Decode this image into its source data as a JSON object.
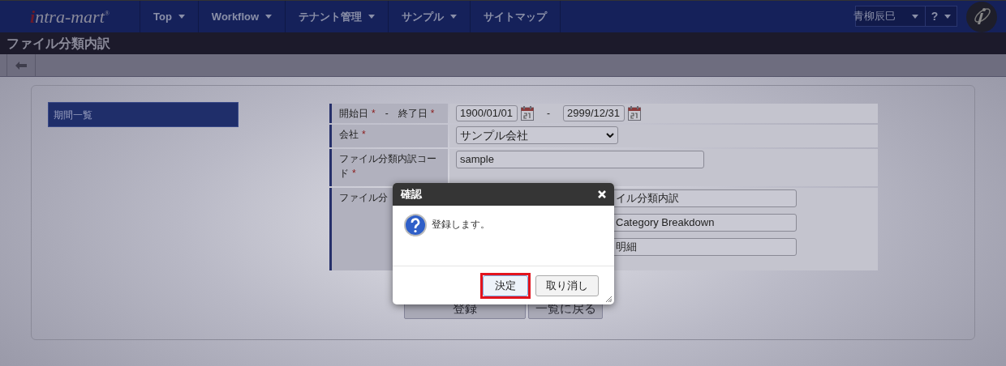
{
  "header": {
    "logo": "intra-mart",
    "logo_mark": "®",
    "nav": [
      {
        "label": "Top",
        "dropdown": true
      },
      {
        "label": "Workflow",
        "dropdown": true
      },
      {
        "label": "テナント管理",
        "dropdown": true
      },
      {
        "label": "サンプル",
        "dropdown": true
      },
      {
        "label": "サイトマップ",
        "dropdown": false
      }
    ],
    "user": "青柳辰巳",
    "help": "?"
  },
  "page_title": "ファイル分類内訳",
  "sidebar": {
    "items": [
      {
        "label": "期間一覧",
        "selected": true
      }
    ]
  },
  "form": {
    "rows": [
      {
        "kind": "date_range",
        "label": "開始日",
        "label2": "終了日",
        "separator": "-",
        "required_mark": "*",
        "required_mark2": "*",
        "from": "1900/01/01",
        "to": "2999/12/31"
      },
      {
        "kind": "select",
        "label": "会社",
        "required_mark": "*",
        "value": "サンプル会社"
      },
      {
        "kind": "text",
        "label": "ファイル分類内訳コード",
        "required_mark": "*",
        "value": "sample"
      },
      {
        "kind": "multi",
        "label": "ファイル分",
        "values": [
          "イル分類内訳",
          "Category Breakdown",
          "明細"
        ]
      }
    ],
    "buttons": [
      "登録",
      "一覧に戻る"
    ]
  },
  "dialog": {
    "title": "確認",
    "message": "登録します。",
    "buttons": [
      {
        "label": "決定",
        "highlighted": true
      },
      {
        "label": "取り消し",
        "highlighted": false
      }
    ]
  }
}
